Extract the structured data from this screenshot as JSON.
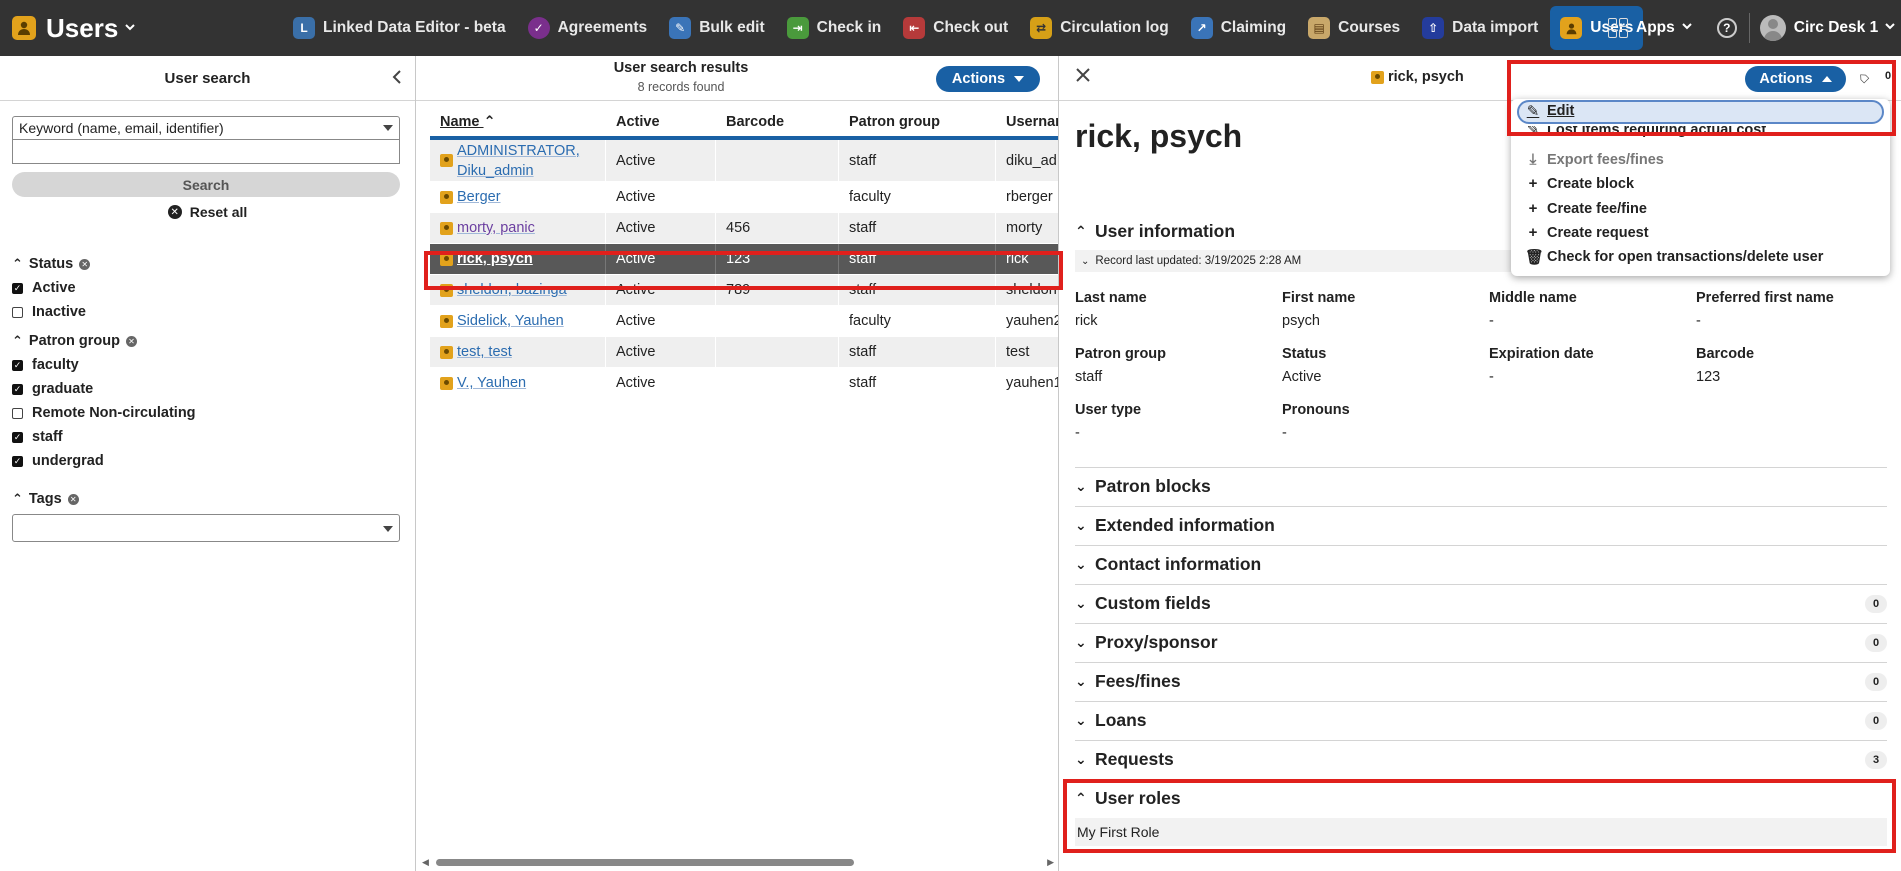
{
  "topbar": {
    "app_title": "Users",
    "nav": [
      {
        "label": "Linked Data Editor - beta",
        "color": "#3a6fa8",
        "glyph": "L"
      },
      {
        "label": "Agreements",
        "color": "#7a2f8c",
        "glyph": "✓"
      },
      {
        "label": "Bulk edit",
        "color": "#3a74b8",
        "glyph": "✎"
      },
      {
        "label": "Check in",
        "color": "#4a9a3c",
        "glyph": "⇥"
      },
      {
        "label": "Check out",
        "color": "#b63a3a",
        "glyph": "⇤"
      },
      {
        "label": "Circulation log",
        "color": "#d6a017",
        "glyph": "⇄"
      },
      {
        "label": "Claiming",
        "color": "#3a74b8",
        "glyph": "↗"
      },
      {
        "label": "Courses",
        "color": "#c9a86a",
        "glyph": "▤"
      },
      {
        "label": "Data import",
        "color": "#243c9c",
        "glyph": "⇧"
      },
      {
        "label": "Users",
        "color": "#e2a21c",
        "glyph": "●"
      }
    ],
    "apps_label": "Apps",
    "profile_label": "Circ Desk 1"
  },
  "search_pane": {
    "title": "User search",
    "search_field": "Keyword (name, email, identifier)",
    "search_value": "",
    "search_button": "Search",
    "reset_button": "Reset all",
    "status": {
      "label": "Status",
      "options": [
        {
          "label": "Active",
          "checked": true
        },
        {
          "label": "Inactive",
          "checked": false
        }
      ]
    },
    "patron_group": {
      "label": "Patron group",
      "options": [
        {
          "label": "faculty",
          "checked": true
        },
        {
          "label": "graduate",
          "checked": true
        },
        {
          "label": "Remote Non-circulating",
          "checked": false
        },
        {
          "label": "staff",
          "checked": true
        },
        {
          "label": "undergrad",
          "checked": true
        }
      ]
    },
    "tags": {
      "label": "Tags",
      "value": ""
    }
  },
  "results_pane": {
    "title": "User search results",
    "subtitle": "8 records found",
    "actions_label": "Actions",
    "columns": [
      "Name",
      "Active",
      "Barcode",
      "Patron group",
      "Usernar"
    ],
    "rows": [
      {
        "name": "ADMINISTRATOR, Diku_admin",
        "active": "Active",
        "barcode": "",
        "group": "staff",
        "username": "diku_ad"
      },
      {
        "name": "Berger",
        "active": "Active",
        "barcode": "",
        "group": "faculty",
        "username": "rberger"
      },
      {
        "name": "morty, panic",
        "active": "Active",
        "barcode": "456",
        "group": "staff",
        "username": "morty"
      },
      {
        "name": "rick, psych",
        "active": "Active",
        "barcode": "123",
        "group": "staff",
        "username": "rick",
        "selected": true
      },
      {
        "name": "sheldon, bazinga",
        "active": "Active",
        "barcode": "789",
        "group": "staff",
        "username": "sheldon"
      },
      {
        "name": "Sidelick, Yauhen",
        "active": "Active",
        "barcode": "",
        "group": "faculty",
        "username": "yauhen2"
      },
      {
        "name": "test, test",
        "active": "Active",
        "barcode": "",
        "group": "staff",
        "username": "test"
      },
      {
        "name": "V., Yauhen",
        "active": "Active",
        "barcode": "",
        "group": "staff",
        "username": "yauhen1"
      }
    ]
  },
  "detail_pane": {
    "header_title": "rick, psych",
    "actions_label": "Actions",
    "tag_count": "0",
    "name": "rick, psych",
    "user_information": {
      "label": "User information",
      "record_updated": "Record last updated: 3/19/2025 2:28 AM",
      "fields": {
        "last_name": {
          "label": "Last name",
          "value": "rick"
        },
        "first_name": {
          "label": "First name",
          "value": "psych"
        },
        "middle_name": {
          "label": "Middle name",
          "value": "-"
        },
        "preferred_first_name": {
          "label": "Preferred first name",
          "value": "-"
        },
        "patron_group": {
          "label": "Patron group",
          "value": "staff"
        },
        "status": {
          "label": "Status",
          "value": "Active"
        },
        "expiration_date": {
          "label": "Expiration date",
          "value": "-"
        },
        "barcode": {
          "label": "Barcode",
          "value": "123"
        },
        "user_type": {
          "label": "User type",
          "value": "-"
        },
        "pronouns": {
          "label": "Pronouns",
          "value": "-"
        }
      }
    },
    "sections": [
      {
        "label": "Patron blocks",
        "count": ""
      },
      {
        "label": "Extended information",
        "count": ""
      },
      {
        "label": "Contact information",
        "count": ""
      },
      {
        "label": "Custom fields",
        "count": "0"
      },
      {
        "label": "Proxy/sponsor",
        "count": "0"
      },
      {
        "label": "Fees/fines",
        "count": "0"
      },
      {
        "label": "Loans",
        "count": "0"
      },
      {
        "label": "Requests",
        "count": "3"
      }
    ],
    "user_roles": {
      "label": "User roles",
      "roles": [
        "My First Role"
      ]
    }
  },
  "actions_menu": {
    "items": [
      {
        "label": "Edit",
        "icon": "pencil-icon"
      },
      {
        "label": "Lost items requiring actual cost",
        "icon": "pencil-icon"
      },
      {
        "label": "Export fees/fines",
        "icon": "download-icon"
      },
      {
        "label": "Create block",
        "icon": "plus-icon"
      },
      {
        "label": "Create fee/fine",
        "icon": "plus-icon"
      },
      {
        "label": "Create request",
        "icon": "plus-icon"
      },
      {
        "label": "Check for open transactions/delete user",
        "icon": "trash-icon"
      }
    ]
  },
  "colors": {
    "accent": "#1960a4",
    "topbar": "#333333",
    "highlight": "#e0201c",
    "users_icon": "#e2a21c"
  }
}
